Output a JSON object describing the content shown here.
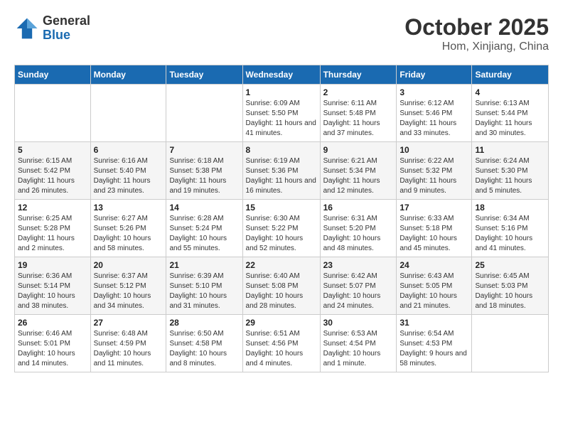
{
  "header": {
    "logo_general": "General",
    "logo_blue": "Blue",
    "month_title": "October 2025",
    "location": "Hom, Xinjiang, China"
  },
  "weekdays": [
    "Sunday",
    "Monday",
    "Tuesday",
    "Wednesday",
    "Thursday",
    "Friday",
    "Saturday"
  ],
  "weeks": [
    [
      {
        "day": "",
        "sunrise": "",
        "sunset": "",
        "daylight": ""
      },
      {
        "day": "",
        "sunrise": "",
        "sunset": "",
        "daylight": ""
      },
      {
        "day": "",
        "sunrise": "",
        "sunset": "",
        "daylight": ""
      },
      {
        "day": "1",
        "sunrise": "Sunrise: 6:09 AM",
        "sunset": "Sunset: 5:50 PM",
        "daylight": "Daylight: 11 hours and 41 minutes."
      },
      {
        "day": "2",
        "sunrise": "Sunrise: 6:11 AM",
        "sunset": "Sunset: 5:48 PM",
        "daylight": "Daylight: 11 hours and 37 minutes."
      },
      {
        "day": "3",
        "sunrise": "Sunrise: 6:12 AM",
        "sunset": "Sunset: 5:46 PM",
        "daylight": "Daylight: 11 hours and 33 minutes."
      },
      {
        "day": "4",
        "sunrise": "Sunrise: 6:13 AM",
        "sunset": "Sunset: 5:44 PM",
        "daylight": "Daylight: 11 hours and 30 minutes."
      }
    ],
    [
      {
        "day": "5",
        "sunrise": "Sunrise: 6:15 AM",
        "sunset": "Sunset: 5:42 PM",
        "daylight": "Daylight: 11 hours and 26 minutes."
      },
      {
        "day": "6",
        "sunrise": "Sunrise: 6:16 AM",
        "sunset": "Sunset: 5:40 PM",
        "daylight": "Daylight: 11 hours and 23 minutes."
      },
      {
        "day": "7",
        "sunrise": "Sunrise: 6:18 AM",
        "sunset": "Sunset: 5:38 PM",
        "daylight": "Daylight: 11 hours and 19 minutes."
      },
      {
        "day": "8",
        "sunrise": "Sunrise: 6:19 AM",
        "sunset": "Sunset: 5:36 PM",
        "daylight": "Daylight: 11 hours and 16 minutes."
      },
      {
        "day": "9",
        "sunrise": "Sunrise: 6:21 AM",
        "sunset": "Sunset: 5:34 PM",
        "daylight": "Daylight: 11 hours and 12 minutes."
      },
      {
        "day": "10",
        "sunrise": "Sunrise: 6:22 AM",
        "sunset": "Sunset: 5:32 PM",
        "daylight": "Daylight: 11 hours and 9 minutes."
      },
      {
        "day": "11",
        "sunrise": "Sunrise: 6:24 AM",
        "sunset": "Sunset: 5:30 PM",
        "daylight": "Daylight: 11 hours and 5 minutes."
      }
    ],
    [
      {
        "day": "12",
        "sunrise": "Sunrise: 6:25 AM",
        "sunset": "Sunset: 5:28 PM",
        "daylight": "Daylight: 11 hours and 2 minutes."
      },
      {
        "day": "13",
        "sunrise": "Sunrise: 6:27 AM",
        "sunset": "Sunset: 5:26 PM",
        "daylight": "Daylight: 10 hours and 58 minutes."
      },
      {
        "day": "14",
        "sunrise": "Sunrise: 6:28 AM",
        "sunset": "Sunset: 5:24 PM",
        "daylight": "Daylight: 10 hours and 55 minutes."
      },
      {
        "day": "15",
        "sunrise": "Sunrise: 6:30 AM",
        "sunset": "Sunset: 5:22 PM",
        "daylight": "Daylight: 10 hours and 52 minutes."
      },
      {
        "day": "16",
        "sunrise": "Sunrise: 6:31 AM",
        "sunset": "Sunset: 5:20 PM",
        "daylight": "Daylight: 10 hours and 48 minutes."
      },
      {
        "day": "17",
        "sunrise": "Sunrise: 6:33 AM",
        "sunset": "Sunset: 5:18 PM",
        "daylight": "Daylight: 10 hours and 45 minutes."
      },
      {
        "day": "18",
        "sunrise": "Sunrise: 6:34 AM",
        "sunset": "Sunset: 5:16 PM",
        "daylight": "Daylight: 10 hours and 41 minutes."
      }
    ],
    [
      {
        "day": "19",
        "sunrise": "Sunrise: 6:36 AM",
        "sunset": "Sunset: 5:14 PM",
        "daylight": "Daylight: 10 hours and 38 minutes."
      },
      {
        "day": "20",
        "sunrise": "Sunrise: 6:37 AM",
        "sunset": "Sunset: 5:12 PM",
        "daylight": "Daylight: 10 hours and 34 minutes."
      },
      {
        "day": "21",
        "sunrise": "Sunrise: 6:39 AM",
        "sunset": "Sunset: 5:10 PM",
        "daylight": "Daylight: 10 hours and 31 minutes."
      },
      {
        "day": "22",
        "sunrise": "Sunrise: 6:40 AM",
        "sunset": "Sunset: 5:08 PM",
        "daylight": "Daylight: 10 hours and 28 minutes."
      },
      {
        "day": "23",
        "sunrise": "Sunrise: 6:42 AM",
        "sunset": "Sunset: 5:07 PM",
        "daylight": "Daylight: 10 hours and 24 minutes."
      },
      {
        "day": "24",
        "sunrise": "Sunrise: 6:43 AM",
        "sunset": "Sunset: 5:05 PM",
        "daylight": "Daylight: 10 hours and 21 minutes."
      },
      {
        "day": "25",
        "sunrise": "Sunrise: 6:45 AM",
        "sunset": "Sunset: 5:03 PM",
        "daylight": "Daylight: 10 hours and 18 minutes."
      }
    ],
    [
      {
        "day": "26",
        "sunrise": "Sunrise: 6:46 AM",
        "sunset": "Sunset: 5:01 PM",
        "daylight": "Daylight: 10 hours and 14 minutes."
      },
      {
        "day": "27",
        "sunrise": "Sunrise: 6:48 AM",
        "sunset": "Sunset: 4:59 PM",
        "daylight": "Daylight: 10 hours and 11 minutes."
      },
      {
        "day": "28",
        "sunrise": "Sunrise: 6:50 AM",
        "sunset": "Sunset: 4:58 PM",
        "daylight": "Daylight: 10 hours and 8 minutes."
      },
      {
        "day": "29",
        "sunrise": "Sunrise: 6:51 AM",
        "sunset": "Sunset: 4:56 PM",
        "daylight": "Daylight: 10 hours and 4 minutes."
      },
      {
        "day": "30",
        "sunrise": "Sunrise: 6:53 AM",
        "sunset": "Sunset: 4:54 PM",
        "daylight": "Daylight: 10 hours and 1 minute."
      },
      {
        "day": "31",
        "sunrise": "Sunrise: 6:54 AM",
        "sunset": "Sunset: 4:53 PM",
        "daylight": "Daylight: 9 hours and 58 minutes."
      },
      {
        "day": "",
        "sunrise": "",
        "sunset": "",
        "daylight": ""
      }
    ]
  ]
}
